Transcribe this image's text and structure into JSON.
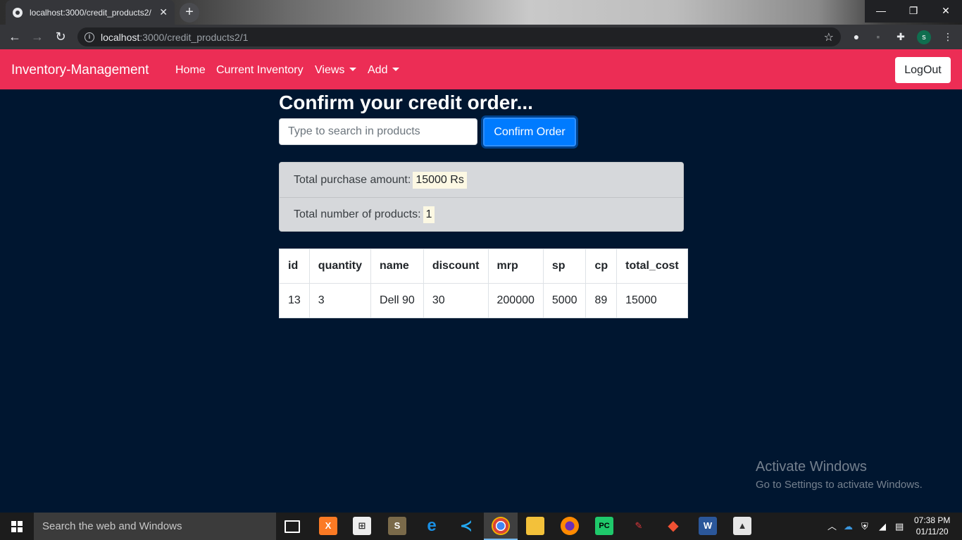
{
  "browser": {
    "tab_title": "localhost:3000/credit_products2/",
    "tab_close": "✕",
    "new_tab": "+",
    "url_host": "localhost",
    "url_path": ":3000/credit_products2/1",
    "profile_initial": "s",
    "window_controls": {
      "minimize": "—",
      "restore": "❐",
      "close": "✕"
    }
  },
  "navbar": {
    "brand": "Inventory-Management",
    "links": {
      "home": "Home",
      "current_inventory": "Current Inventory",
      "views": "Views",
      "add": "Add"
    },
    "logout": "LogOut",
    "color": "#ec2d55"
  },
  "page": {
    "heading": "Confirm your credit order...",
    "search_placeholder": "Type to search in products",
    "confirm_button": "Confirm Order",
    "summary": {
      "amount_label": "Total purchase amount:",
      "amount_value": "15000 Rs",
      "count_label": "Total number of products:",
      "count_value": "1"
    },
    "table": {
      "headers": [
        "id",
        "quantity",
        "name",
        "discount",
        "mrp",
        "sp",
        "cp",
        "total_cost"
      ],
      "rows": [
        [
          "13",
          "3",
          "Dell 90",
          "30",
          "200000",
          "5000",
          "89",
          "15000"
        ]
      ]
    },
    "background": "#001630"
  },
  "watermark": {
    "line1": "Activate Windows",
    "line2": "Go to Settings to activate Windows."
  },
  "taskbar": {
    "search_placeholder": "Search the web and Windows",
    "time": "07:38 PM",
    "date": "01/11/20"
  }
}
